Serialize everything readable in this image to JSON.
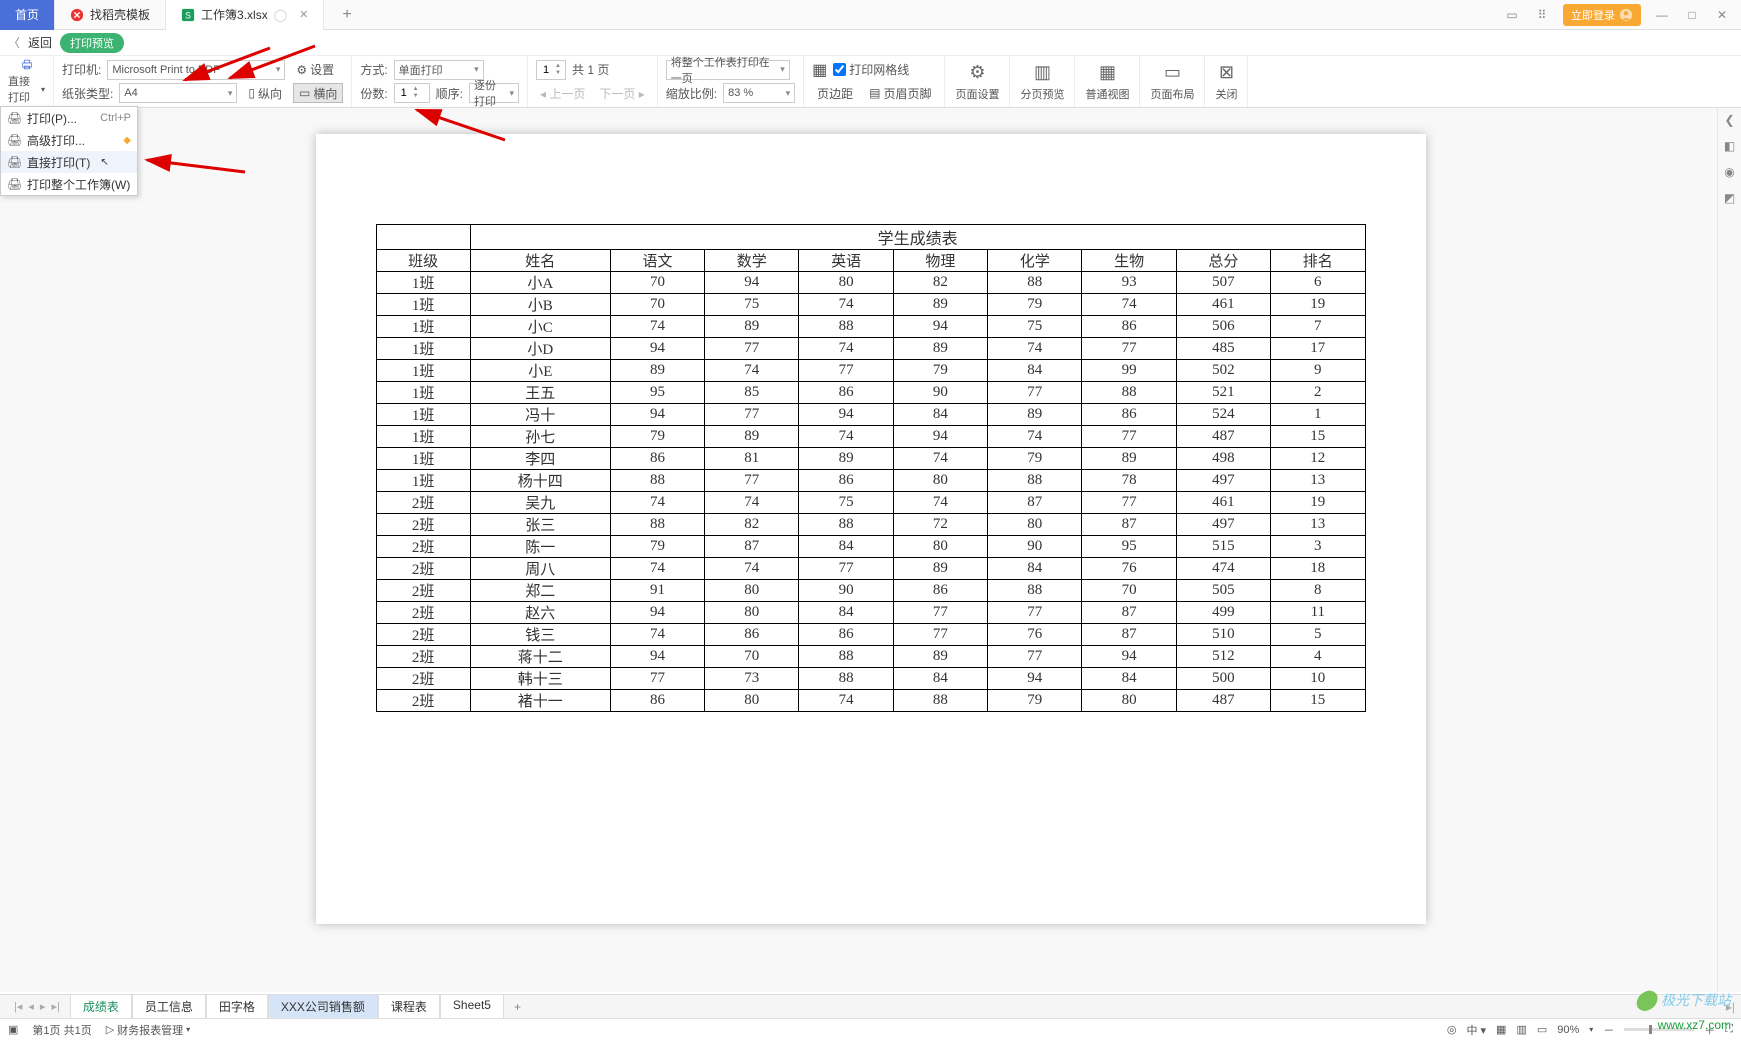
{
  "top_tabs": {
    "home": "首页",
    "template": "找稻壳模板",
    "file": "工作簿3.xlsx",
    "login": "立即登录"
  },
  "return_bar": {
    "back": "返回",
    "title": "打印预览"
  },
  "toolbar": {
    "direct_print": "直接打印",
    "printer_label": "打印机:",
    "printer_value": "Microsoft Print to PDF",
    "paper_label": "纸张类型:",
    "paper_value": "A4",
    "settings": "设置",
    "mode_label": "方式:",
    "mode_value": "单面打印",
    "portrait": "纵向",
    "landscape": "横向",
    "copies_label": "份数:",
    "copies_value": "1",
    "order_label": "顺序:",
    "order_value": "逐份打印",
    "page_count_value": "1",
    "page_total": "共 1 页",
    "prev_page": "上一页",
    "next_page": "下一页",
    "fit_label_value": "将整个工作表打印在一页",
    "scale_label": "缩放比例:",
    "scale_value": "83 %",
    "gridlines": "打印网格线",
    "margins": "页边距",
    "header_footer": "页眉页脚",
    "page_setup": "页面设置",
    "page_break": "分页预览",
    "normal_view": "普通视图",
    "page_layout": "页面布局",
    "close": "关闭"
  },
  "menu": {
    "print_p": "打印(P)...",
    "print_p_shortcut": "Ctrl+P",
    "advanced": "高级打印...",
    "direct_t": "直接打印(T)",
    "whole_wb": "打印整个工作簿(W)"
  },
  "chart_data": {
    "type": "table",
    "title": "学生成绩表",
    "headers": [
      "班级",
      "姓名",
      "语文",
      "数学",
      "英语",
      "物理",
      "化学",
      "生物",
      "总分",
      "排名"
    ],
    "rows": [
      [
        "1班",
        "小A",
        "70",
        "94",
        "80",
        "82",
        "88",
        "93",
        "507",
        "6"
      ],
      [
        "1班",
        "小B",
        "70",
        "75",
        "74",
        "89",
        "79",
        "74",
        "461",
        "19"
      ],
      [
        "1班",
        "小C",
        "74",
        "89",
        "88",
        "94",
        "75",
        "86",
        "506",
        "7"
      ],
      [
        "1班",
        "小D",
        "94",
        "77",
        "74",
        "89",
        "74",
        "77",
        "485",
        "17"
      ],
      [
        "1班",
        "小E",
        "89",
        "74",
        "77",
        "79",
        "84",
        "99",
        "502",
        "9"
      ],
      [
        "1班",
        "王五",
        "95",
        "85",
        "86",
        "90",
        "77",
        "88",
        "521",
        "2"
      ],
      [
        "1班",
        "冯十",
        "94",
        "77",
        "94",
        "84",
        "89",
        "86",
        "524",
        "1"
      ],
      [
        "1班",
        "孙七",
        "79",
        "89",
        "74",
        "94",
        "74",
        "77",
        "487",
        "15"
      ],
      [
        "1班",
        "李四",
        "86",
        "81",
        "89",
        "74",
        "79",
        "89",
        "498",
        "12"
      ],
      [
        "1班",
        "杨十四",
        "88",
        "77",
        "86",
        "80",
        "88",
        "78",
        "497",
        "13"
      ],
      [
        "2班",
        "吴九",
        "74",
        "74",
        "75",
        "74",
        "87",
        "77",
        "461",
        "19"
      ],
      [
        "2班",
        "张三",
        "88",
        "82",
        "88",
        "72",
        "80",
        "87",
        "497",
        "13"
      ],
      [
        "2班",
        "陈一",
        "79",
        "87",
        "84",
        "80",
        "90",
        "95",
        "515",
        "3"
      ],
      [
        "2班",
        "周八",
        "74",
        "74",
        "77",
        "89",
        "84",
        "76",
        "474",
        "18"
      ],
      [
        "2班",
        "郑二",
        "91",
        "80",
        "90",
        "86",
        "88",
        "70",
        "505",
        "8"
      ],
      [
        "2班",
        "赵六",
        "94",
        "80",
        "84",
        "77",
        "77",
        "87",
        "499",
        "11"
      ],
      [
        "2班",
        "钱三",
        "74",
        "86",
        "86",
        "77",
        "76",
        "87",
        "510",
        "5"
      ],
      [
        "2班",
        "蒋十二",
        "94",
        "70",
        "88",
        "89",
        "77",
        "94",
        "512",
        "4"
      ],
      [
        "2班",
        "韩十三",
        "77",
        "73",
        "88",
        "84",
        "94",
        "84",
        "500",
        "10"
      ],
      [
        "2班",
        "褚十一",
        "86",
        "80",
        "74",
        "88",
        "79",
        "80",
        "487",
        "15"
      ]
    ]
  },
  "sheet_tabs": [
    "成绩表",
    "员工信息",
    "田字格",
    "XXX公司销售额",
    "课程表",
    "Sheet5"
  ],
  "status": {
    "page_info": "第1页 共1页",
    "macro": "财务报表管理",
    "zoom": "90%"
  },
  "watermark": {
    "a": "极光下载站",
    "b": "www.xz7.com"
  }
}
